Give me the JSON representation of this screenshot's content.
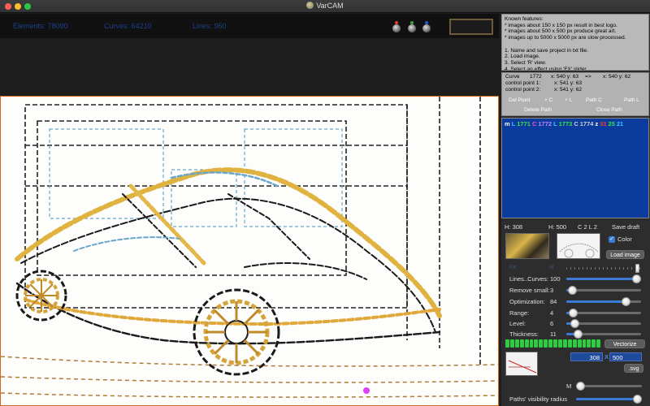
{
  "window": {
    "title": "VarCAM",
    "traffic_lights": [
      "#ff5f57",
      "#febc2e",
      "#28c840"
    ]
  },
  "stats": {
    "elements": "Elements: 78090",
    "curves": "Curves: 64210",
    "lines": "Lines: 960"
  },
  "rgb_dots": [
    "#e53935",
    "#43a047",
    "#1e5bd8"
  ],
  "notes": {
    "lines": [
      "Known features:",
      "* images about 150 x 150 px result in best logo.",
      "* images about 500 x 500 px produce great art.",
      "* images up to 5000 x 5000 px are slow processed.",
      "",
      "1. Name and save project in txt file.",
      "2. Load image.",
      "3. Select 'R' view.",
      "4. Select an effect using 'FX' slider"
    ]
  },
  "curve": {
    "label": "Curve",
    "id": "1772",
    "from": "x: 540 y: 63",
    "arrow": "=>",
    "to": "x: 540 y: 62",
    "cp1_label": "control point 1:",
    "cp1": "x: 541 y: 63",
    "cp2_label": "control point 2:",
    "cp2": "x: 541 y: 62",
    "buttons": {
      "del_point": "Del Point",
      "plus_c": "+ C",
      "plus_l": "+ L",
      "path_c": "Path C",
      "path_l": "Path L",
      "delete_path": "Delete Path",
      "close_path": "Close Path"
    }
  },
  "path_tokens": [
    {
      "t": "m",
      "c": "#ffffff"
    },
    {
      "t": "L",
      "c": "#35c6ff"
    },
    {
      "t": "1771",
      "c": "#3ce04a"
    },
    {
      "t": "C",
      "c": "#ff4fd0"
    },
    {
      "t": "1772",
      "c": "#b888ff"
    },
    {
      "t": "L",
      "c": "#35c6ff"
    },
    {
      "t": "1773",
      "c": "#3ce04a"
    },
    {
      "t": "C",
      "c": "#d0d0d0"
    },
    {
      "t": "1774",
      "c": "#d0d0d0"
    },
    {
      "t": "z",
      "c": "#ffffff"
    },
    {
      "t": "31",
      "c": "#ff3b30"
    },
    {
      "t": "25",
      "c": "#3ce04a"
    },
    {
      "t": "21",
      "c": "#35c6ff"
    }
  ],
  "controls": {
    "height": "H: 308",
    "width": "H: 500",
    "mode": "C 2 L 2",
    "save_draft": "Save draft",
    "color_label": "Color",
    "color_checked": true,
    "load_image": "Load image",
    "fx_label": "FX",
    "fx_tag": "R",
    "fx_value": 0.98,
    "lines_curves_label": "Lines..Curves:",
    "lines_curves": "100",
    "lines_curves_pos": 1.0,
    "remove_small_label": "Remove small:",
    "remove_small": "3",
    "remove_small_pos": 0.03,
    "optimization_label": "Optimization:",
    "optimization": "84",
    "optimization_pos": 0.84,
    "range_label": "Range:",
    "range": "4",
    "range_pos": 0.04,
    "level_label": "Level:",
    "level": "6",
    "level_pos": 0.06,
    "thickness_label": "Thickness:",
    "thickness": "11",
    "thickness_pos": 0.11,
    "vectorize": "Vectorize",
    "progress": 1.0,
    "out_w": "308",
    "x_label": "X",
    "out_h": "500",
    "svg": ".svg",
    "m_label": "M",
    "m_pos": 0.0,
    "visibility_label": "Paths' visibility radius",
    "visibility_pos": 1.0
  }
}
